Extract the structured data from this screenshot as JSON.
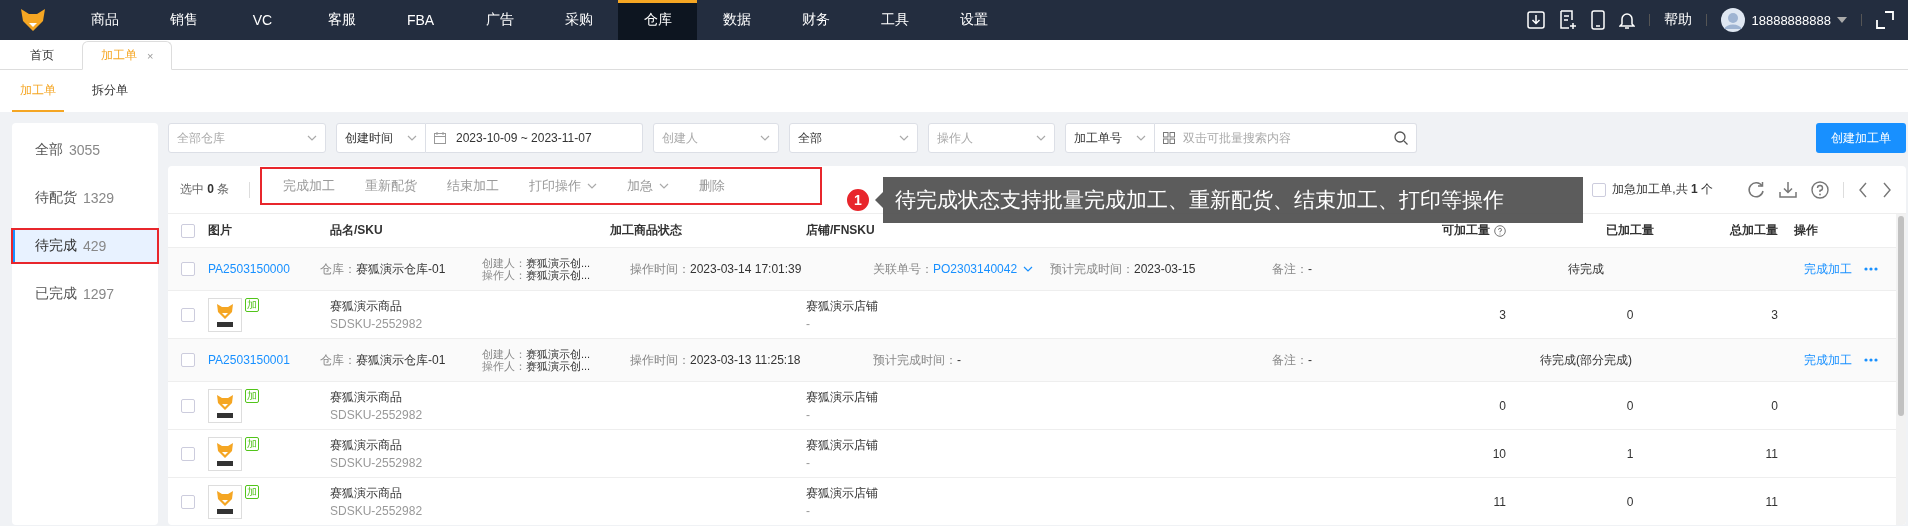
{
  "nav": {
    "items": [
      {
        "label": "商品",
        "selected": false
      },
      {
        "label": "销售",
        "selected": false
      },
      {
        "label": "VC",
        "selected": false
      },
      {
        "label": "客服",
        "selected": false
      },
      {
        "label": "FBA",
        "selected": false
      },
      {
        "label": "广告",
        "selected": false
      },
      {
        "label": "采购",
        "selected": false
      },
      {
        "label": "仓库",
        "selected": true
      },
      {
        "label": "数据",
        "selected": false
      },
      {
        "label": "财务",
        "selected": false
      },
      {
        "label": "工具",
        "selected": false
      },
      {
        "label": "设置",
        "selected": false
      }
    ],
    "help": "帮助",
    "user": "18888888888"
  },
  "page_tabs": [
    {
      "label": "首页",
      "selected": false
    },
    {
      "label": "加工单",
      "selected": true,
      "close": "×"
    }
  ],
  "sub_tabs": [
    {
      "label": "加工单",
      "selected": true
    },
    {
      "label": "拆分单",
      "selected": false
    }
  ],
  "sidebar": {
    "items": [
      {
        "label": "全部",
        "count": "3055",
        "selected": false,
        "annotated": false
      },
      {
        "label": "待配货",
        "count": "1329",
        "selected": false,
        "annotated": false
      },
      {
        "label": "待完成",
        "count": "429",
        "selected": true,
        "annotated": true
      },
      {
        "label": "已完成",
        "count": "1297",
        "selected": false,
        "annotated": false
      }
    ]
  },
  "filters": [
    {
      "kind": "select",
      "placeholder": "全部仓库"
    },
    {
      "kind": "select",
      "value": "创建时间"
    },
    {
      "kind": "daterange",
      "start": "2023-10-09",
      "separator": "~",
      "end": "2023-11-07"
    },
    {
      "kind": "select",
      "placeholder": "创建人"
    },
    {
      "kind": "select",
      "value": "全部"
    },
    {
      "kind": "select",
      "placeholder": "操作人"
    },
    {
      "kind": "select",
      "value": "加工单号"
    },
    {
      "kind": "search",
      "placeholder": "双击可批量搜索内容"
    }
  ],
  "create_button": "创建加工单",
  "toolbar": {
    "selection": "选中 **0** 条",
    "annotated": true,
    "actions": [
      {
        "label": "完成加工",
        "disabled": true,
        "dropdown": false
      },
      {
        "label": "重新配货",
        "disabled": true,
        "dropdown": false
      },
      {
        "label": "结束加工",
        "disabled": true,
        "dropdown": false
      },
      {
        "label": "打印操作",
        "disabled": true,
        "dropdown": true
      },
      {
        "label": "加急",
        "disabled": true,
        "dropdown": true
      },
      {
        "label": "删除",
        "disabled": true,
        "dropdown": false
      }
    ],
    "urgent_filter": {
      "label": "加急加工单,共 **1** 个",
      "checked": false
    }
  },
  "callout": {
    "number": "1",
    "text": "待完成状态支持批量完成加工、重新配货、结束加工、打印等操作"
  },
  "table": {
    "all_selected": false,
    "columns": [
      {
        "label": "图片",
        "kind": "plain"
      },
      {
        "label": "品名/SKU",
        "kind": "plain"
      },
      {
        "label": "加工商品状态",
        "kind": "plain"
      },
      {
        "label": "店铺/FNSKU",
        "kind": "plain"
      },
      {
        "label": "可加工量",
        "kind": "help"
      },
      {
        "label": "已加工量",
        "kind": "plain"
      },
      {
        "label": "总加工量",
        "kind": "plain"
      },
      {
        "label": "操作",
        "kind": "plain"
      }
    ],
    "rows": [
      {
        "kind": "order",
        "selected": false,
        "id": "PA2503150000",
        "warehouse_label": "仓库：",
        "warehouse": "赛狐演示仓库-01",
        "creator_label": "创建人：",
        "creator": "赛狐演示创...",
        "operator_label": "操作人：",
        "operator": "赛狐演示创...",
        "time_label": "操作时间：",
        "time": "2023-03-14 17:01:39",
        "ref_label": "关联单号：",
        "ref": "PO2303140042",
        "eta_label": "预计完成时间：",
        "eta": "2023-03-15",
        "note_label": "备注：",
        "note": "-",
        "status": "待完成",
        "action": "完成加工"
      },
      {
        "kind": "item",
        "selected": false,
        "tag": "加",
        "name": "赛狐演示商品",
        "sku": "SDSKU-2552982",
        "shop": "赛狐演示店铺",
        "fnsku": "-",
        "available": "3",
        "processed": "0",
        "total": "3"
      },
      {
        "kind": "order",
        "selected": false,
        "id": "PA2503150001",
        "warehouse_label": "仓库：",
        "warehouse": "赛狐演示仓库-01",
        "creator_label": "创建人：",
        "creator": "赛狐演示创...",
        "operator_label": "操作人：",
        "operator": "赛狐演示创...",
        "time_label": "操作时间：",
        "time": "2023-03-13 11:25:18",
        "eta_label": "预计完成时间：",
        "eta": "-",
        "note_label": "备注：",
        "note": "-",
        "status": "待完成(部分完成)",
        "action": "完成加工"
      },
      {
        "kind": "item",
        "selected": false,
        "tag": "加",
        "name": "赛狐演示商品",
        "sku": "SDSKU-2552982",
        "shop": "赛狐演示店铺",
        "fnsku": "-",
        "available": "0",
        "processed": "0",
        "total": "0"
      },
      {
        "kind": "item",
        "selected": false,
        "tag": "加",
        "name": "赛狐演示商品",
        "sku": "SDSKU-2552982",
        "shop": "赛狐演示店铺",
        "fnsku": "-",
        "available": "10",
        "processed": "1",
        "total": "11"
      },
      {
        "kind": "item",
        "selected": false,
        "tag": "加",
        "name": "赛狐演示商品",
        "sku": "SDSKU-2552982",
        "shop": "赛狐演示店铺",
        "fnsku": "-",
        "available": "11",
        "processed": "0",
        "total": "11"
      }
    ]
  }
}
